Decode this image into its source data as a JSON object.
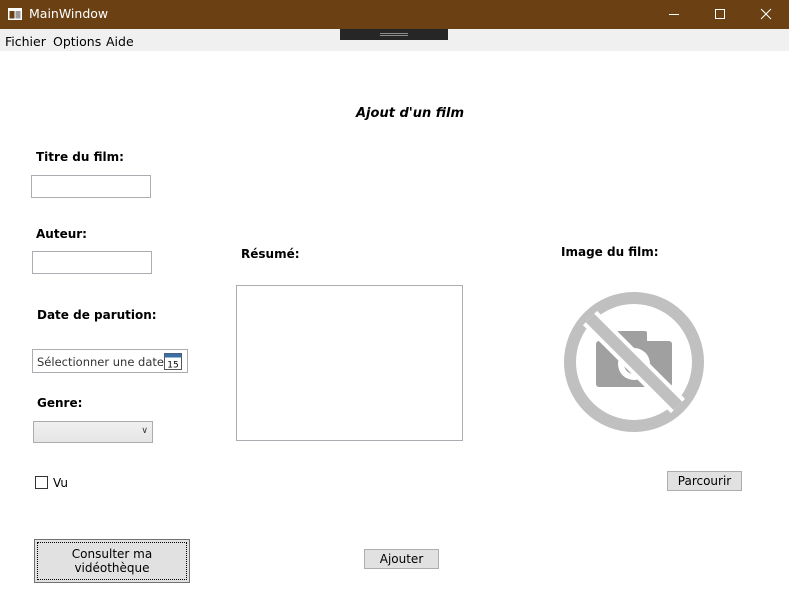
{
  "window": {
    "title": "MainWindow"
  },
  "menu": {
    "items": [
      "Fichier",
      "Options",
      "Aide"
    ]
  },
  "form": {
    "heading": "Ajout d'un film",
    "title_label": "Titre du film:",
    "title_value": "",
    "author_label": "Auteur:",
    "author_value": "",
    "date_label": "Date de parution:",
    "date_placeholder": "Sélectionner une date",
    "calendar_day": "15",
    "genre_label": "Genre:",
    "genre_value": "",
    "summary_label": "Résumé:",
    "summary_value": "",
    "image_label": "Image du film:",
    "seen_label": "Vu",
    "seen_checked": false,
    "browse_button": "Parcourir",
    "add_button": "Ajouter",
    "library_button": "Consulter ma vidéothèque"
  },
  "colors": {
    "titlebar": "#6b4114",
    "menubar": "#f0f0f0",
    "button": "#e1e1e1",
    "image_icon": "#c0c0c0"
  },
  "icons": {
    "image_placeholder": "no-photo-icon",
    "calendar": "calendar-icon"
  }
}
